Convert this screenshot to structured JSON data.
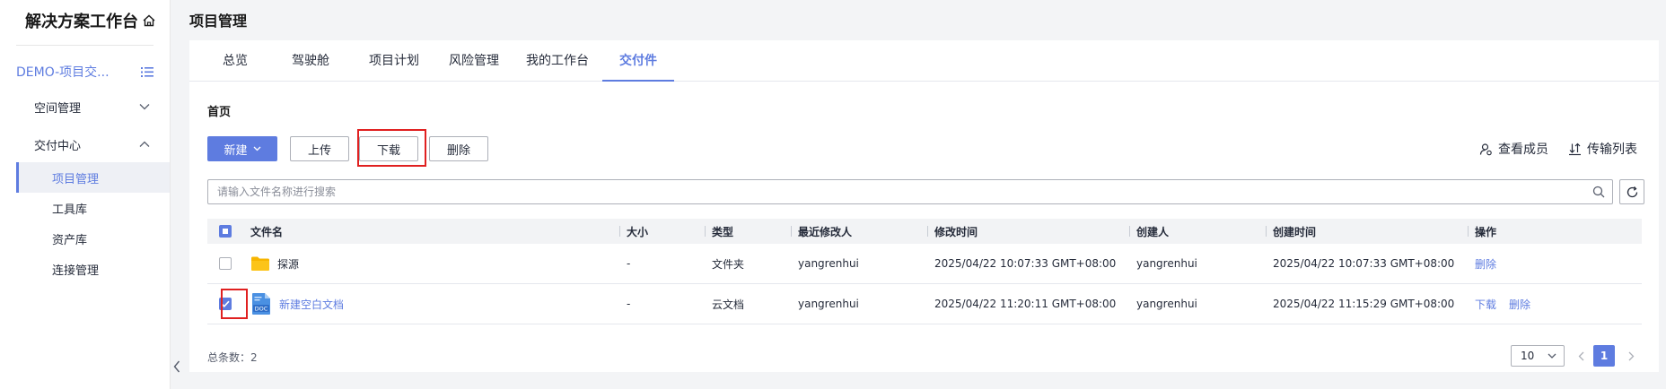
{
  "sidebar": {
    "brand": "解决方案工作台",
    "project": "DEMO-项目交...",
    "groups": [
      {
        "label": "空间管理"
      },
      {
        "label": "交付中心"
      }
    ],
    "items": [
      {
        "label": "项目管理"
      },
      {
        "label": "工具库"
      },
      {
        "label": "资产库"
      },
      {
        "label": "连接管理"
      }
    ]
  },
  "header": {
    "title": "项目管理"
  },
  "tabs": [
    {
      "label": "总览"
    },
    {
      "label": "驾驶舱"
    },
    {
      "label": "项目计划"
    },
    {
      "label": "风险管理"
    },
    {
      "label": "我的工作台"
    },
    {
      "label": "交付件"
    }
  ],
  "breadcrumb": "首页",
  "toolbar": {
    "new_label": "新建",
    "upload_label": "上传",
    "download_label": "下载",
    "delete_label": "删除",
    "members_label": "查看成员",
    "transfer_label": "传输列表"
  },
  "search": {
    "placeholder": "请输入文件名称进行搜索"
  },
  "table": {
    "headers": {
      "name": "文件名",
      "size": "大小",
      "type": "类型",
      "modifier": "最近修改人",
      "mtime": "修改时间",
      "creator": "创建人",
      "ctime": "创建时间",
      "ops": "操作"
    },
    "rows": [
      {
        "name": "探源",
        "size": "-",
        "type": "文件夹",
        "modifier": "yangrenhui",
        "mtime": "2025/04/22 10:07:33 GMT+08:00",
        "creator": "yangrenhui",
        "ctime": "2025/04/22 10:07:33 GMT+08:00",
        "op_delete": "删除",
        "icon": "folder-icon",
        "checked": false
      },
      {
        "name": "新建空白文档",
        "size": "-",
        "type": "云文档",
        "modifier": "yangrenhui",
        "mtime": "2025/04/22 11:20:11 GMT+08:00",
        "creator": "yangrenhui",
        "ctime": "2025/04/22 11:15:29 GMT+08:00",
        "op_download": "下载",
        "op_delete": "删除",
        "icon": "doc-file-icon",
        "icon_text": "DOC",
        "checked": true
      }
    ]
  },
  "footer": {
    "total": "总条数：2",
    "page_size": "10",
    "current_page": "1"
  },
  "colors": {
    "accent": "#5e7ce0",
    "highlight": "#e02020",
    "folder": "#f7b500"
  }
}
